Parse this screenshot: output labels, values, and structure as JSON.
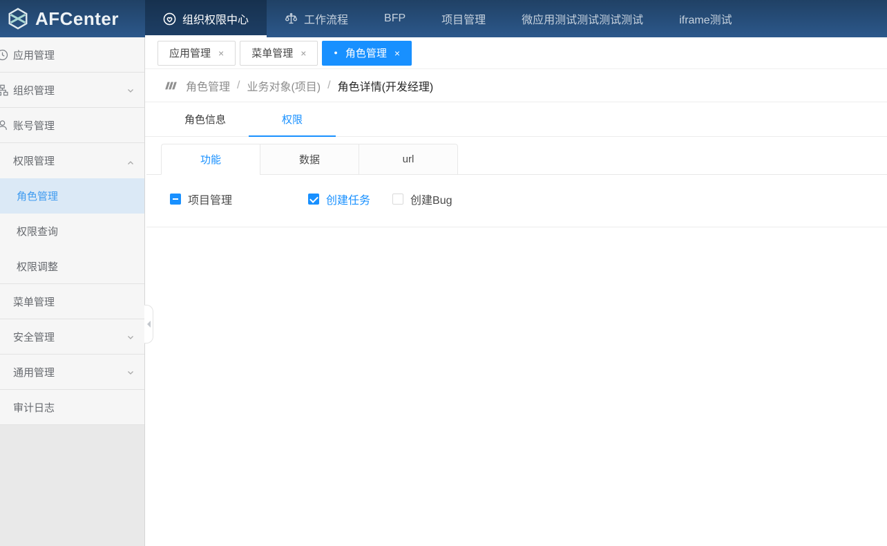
{
  "brand": {
    "name": "AFCenter"
  },
  "topnav": {
    "items": [
      {
        "label": "组织权限中心",
        "icon": "heart-badge-icon",
        "active": true
      },
      {
        "label": "工作流程",
        "icon": "scale-icon",
        "active": false
      },
      {
        "label": "BFP",
        "icon": "",
        "active": false
      },
      {
        "label": "项目管理",
        "icon": "",
        "active": false
      },
      {
        "label": "微应用测试测试测试测试",
        "icon": "",
        "active": false
      },
      {
        "label": "iframe测试",
        "icon": "",
        "active": false
      }
    ]
  },
  "sidebar": {
    "items": [
      {
        "label": "应用管理",
        "icon": "clock-icon",
        "level": 1,
        "selected": false,
        "chevron": ""
      },
      {
        "label": "组织管理",
        "icon": "org-chart-icon",
        "level": 1,
        "selected": false,
        "chevron": "down"
      },
      {
        "label": "账号管理",
        "icon": "user-icon",
        "level": 1,
        "selected": false,
        "chevron": ""
      },
      {
        "label": "权限管理",
        "icon": "",
        "level": 1,
        "selected": false,
        "chevron": "up"
      },
      {
        "label": "角色管理",
        "icon": "",
        "level": 2,
        "selected": true,
        "chevron": ""
      },
      {
        "label": "权限查询",
        "icon": "",
        "level": 2,
        "selected": false,
        "chevron": ""
      },
      {
        "label": "权限调整",
        "icon": "",
        "level": 2,
        "selected": false,
        "chevron": ""
      },
      {
        "label": "菜单管理",
        "icon": "",
        "level": 1,
        "selected": false,
        "chevron": ""
      },
      {
        "label": "安全管理",
        "icon": "",
        "level": 1,
        "selected": false,
        "chevron": "down"
      },
      {
        "label": "通用管理",
        "icon": "",
        "level": 1,
        "selected": false,
        "chevron": "down"
      },
      {
        "label": "审计日志",
        "icon": "",
        "level": 1,
        "selected": false,
        "chevron": ""
      }
    ]
  },
  "tabbar": {
    "close_glyph": "×",
    "active_dot": "●",
    "tabs": [
      {
        "label": "应用管理",
        "active": false
      },
      {
        "label": "菜单管理",
        "active": false
      },
      {
        "label": "角色管理",
        "active": true
      }
    ]
  },
  "breadcrumb": {
    "separator": "/",
    "items": [
      {
        "label": "角色管理",
        "current": false
      },
      {
        "label": "业务对象(项目)",
        "current": false
      },
      {
        "label": "角色详情(开发经理)",
        "current": true
      }
    ]
  },
  "role_tabs": [
    {
      "label": "角色信息",
      "active": false
    },
    {
      "label": "权限",
      "active": true
    }
  ],
  "perm_tabs": [
    {
      "label": "功能",
      "active": true
    },
    {
      "label": "数据",
      "active": false
    },
    {
      "label": "url",
      "active": false
    }
  ],
  "perm_tree": {
    "parent": {
      "label": "项目管理",
      "state": "indeterminate"
    },
    "children": [
      {
        "label": "创建任务",
        "state": "checked",
        "highlighted": true
      },
      {
        "label": "创建Bug",
        "state": "unchecked",
        "highlighted": false
      }
    ]
  },
  "colors": {
    "accent_blue": "#1890ff",
    "navbar_top": "#204165",
    "navbar_bottom": "#2c588b",
    "sidebar_selected_bg": "#dbe9f6",
    "sidebar_selected_text": "#3f9bf0"
  }
}
